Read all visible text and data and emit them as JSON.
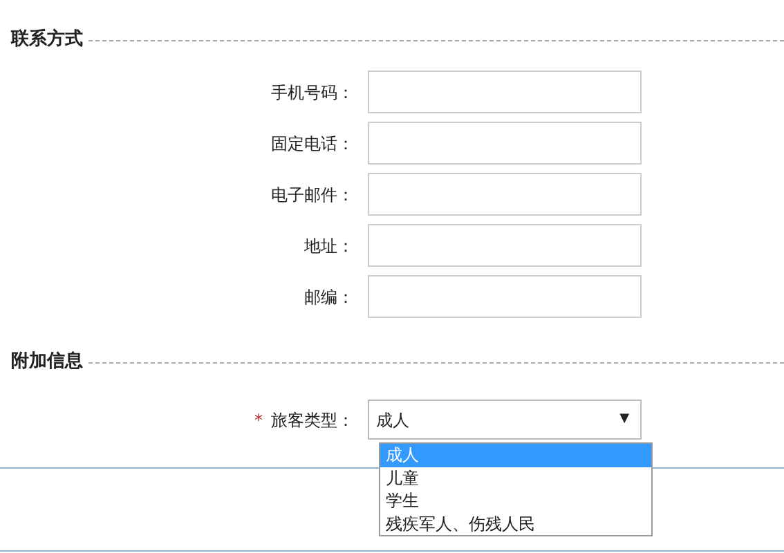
{
  "sections": [
    {
      "title": "联系方式",
      "fields": [
        {
          "label": "手机号码："
        },
        {
          "label": "固定电话："
        },
        {
          "label": "电子邮件："
        },
        {
          "label": "地址："
        },
        {
          "label": "邮编："
        }
      ]
    },
    {
      "title": "附加信息",
      "select": {
        "required_mark": "*",
        "label": "旅客类型：",
        "value": "成人",
        "arrow": "▼",
        "expanded": true,
        "options": [
          {
            "label": "成人",
            "selected": true
          },
          {
            "label": "儿童",
            "selected": false
          },
          {
            "label": "学生",
            "selected": false
          },
          {
            "label": "残疾军人、伤残人民",
            "selected": false
          }
        ]
      }
    }
  ]
}
